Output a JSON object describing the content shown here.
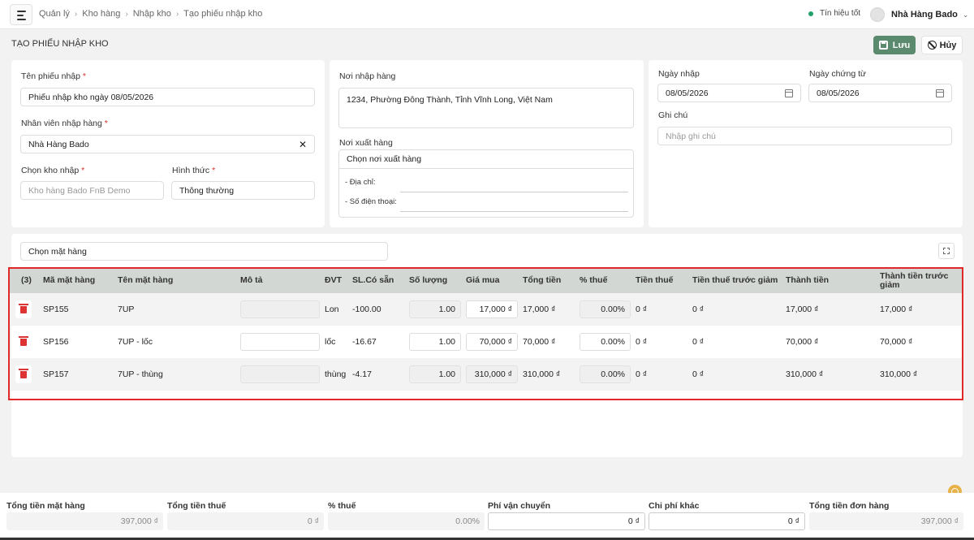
{
  "breadcrumb": [
    "Quản lý",
    "Kho hàng",
    "Nhập kho",
    "Tạo phiếu nhập kho"
  ],
  "header": {
    "signal": "Tín hiệu tốt",
    "store_name": "Nhà Hàng Bado"
  },
  "page": {
    "title": "TẠO PHIẾU NHẬP KHO",
    "save_label": "Lưu",
    "cancel_label": "Hủy"
  },
  "form": {
    "receipt_name_label": "Tên phiếu nhập",
    "receipt_name_value": "Phiếu nhập kho ngày 08/05/2026",
    "staff_label": "Nhân viên nhập hàng",
    "staff_value": "Nhà Hàng Bado",
    "warehouse_label": "Chọn kho nhập",
    "warehouse_placeholder": "Kho hàng Bado FnB Demo",
    "type_label": "Hình thức",
    "type_value": "Thông thường",
    "import_place_label": "Nơi nhập hàng",
    "import_place_value": "1234, Phường Đông Thành, Tỉnh Vĩnh Long, Việt Nam",
    "export_place_label": "Nơi xuất hàng",
    "export_place_value": "Chọn nơi xuất hàng",
    "address_label": "- Địa chỉ:",
    "phone_label": "- Số điện thoại:",
    "import_date_label": "Ngày nhập",
    "import_date_value": "08/05/2026",
    "doc_date_label": "Ngày chứng từ",
    "doc_date_value": "08/05/2026",
    "note_label": "Ghi chú",
    "note_placeholder": "Nhập ghi chú"
  },
  "items": {
    "select_placeholder": "Chọn mặt hàng",
    "count": "(3)",
    "columns": [
      "Mã mặt hàng",
      "Tên mặt hàng",
      "Mô tả",
      "ĐVT",
      "SL.Có sẵn",
      "Số lượng",
      "Giá mua",
      "Tổng tiền",
      "% thuế",
      "Tiền thuế",
      "Tiền thuế trước giảm",
      "Thành tiền",
      "Thành tiền trước giảm"
    ],
    "rows": [
      {
        "code": "SP155",
        "name": "7UP",
        "unit": "Lon",
        "stock": "-100.00",
        "qty": "1.00",
        "price": "17,000 ₫",
        "total": "17,000 ₫",
        "tax_pct": "0.00%",
        "tax": "0 ₫",
        "tax_before": "0 ₫",
        "amount": "17,000 ₫",
        "amount_before": "17,000 ₫"
      },
      {
        "code": "SP156",
        "name": "7UP - lốc",
        "unit": "lốc",
        "stock": "-16.67",
        "qty": "1.00",
        "price": "70,000 ₫",
        "total": "70,000 ₫",
        "tax_pct": "0.00%",
        "tax": "0 ₫",
        "tax_before": "0 ₫",
        "amount": "70,000 ₫",
        "amount_before": "70,000 ₫"
      },
      {
        "code": "SP157",
        "name": "7UP - thùng",
        "unit": "thùng",
        "stock": "-4.17",
        "qty": "1.00",
        "price": "310,000 ₫",
        "total": "310,000 ₫",
        "tax_pct": "0.00%",
        "tax": "0 ₫",
        "tax_before": "0 ₫",
        "amount": "310,000 ₫",
        "amount_before": "310,000 ₫"
      }
    ]
  },
  "footer": {
    "items_total_label": "Tổng tiền mặt hàng",
    "items_total": "397,000 ₫",
    "tax_total_label": "Tổng tiền thuế",
    "tax_total": "0 ₫",
    "tax_pct_label": "% thuế",
    "tax_pct": "0.00%",
    "shipping_label": "Phí vận chuyển",
    "shipping": "0 ₫",
    "other_label": "Chi phí khác",
    "other": "0 ₫",
    "order_total_label": "Tổng tiền đơn hàng",
    "order_total": "397,000 ₫"
  },
  "colors": {
    "accent": "#5b8a6f",
    "highlight_border": "#e02a2a",
    "delete": "#dd3333"
  }
}
